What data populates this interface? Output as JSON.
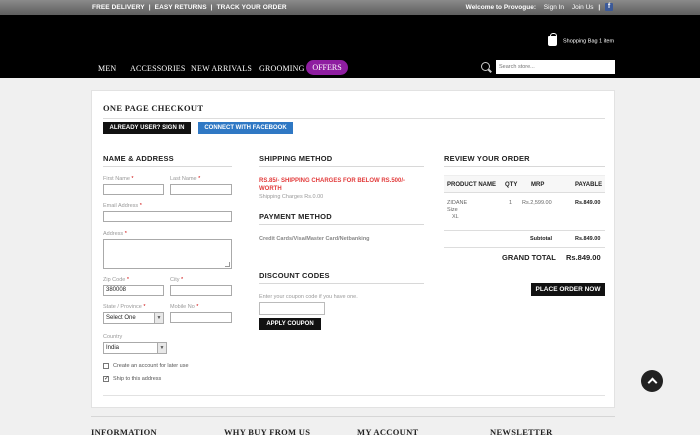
{
  "topbar": {
    "links": [
      "FREE DELIVERY",
      "EASY RETURNS",
      "TRACK YOUR ORDER"
    ],
    "welcome": "Welcome to Provogue:",
    "sign_in": "Sign In",
    "join_us": "Join Us",
    "social_icon": "facebook-icon"
  },
  "header": {
    "bag_label": "Shopping Bag",
    "bag_count": "1 item",
    "nav": [
      "MEN",
      "ACCESSORIES",
      "NEW ARRIVALS",
      "GROOMING",
      "OFFERS"
    ],
    "search_placeholder": "Search store..."
  },
  "checkout": {
    "title": "ONE PAGE CHECKOUT",
    "signin_button": "ALREADY USER? SIGN IN",
    "facebook_button": "CONNECT WITH FACEBOOK"
  },
  "address": {
    "title": "NAME & ADDRESS",
    "first_name_label": "First Name",
    "last_name_label": "Last Name",
    "email_label": "Email Address",
    "address_label": "Address",
    "zip_label": "Zip Code",
    "zip_value": "380008",
    "city_label": "City",
    "state_label": "State / Province",
    "state_value": "Select One",
    "mobile_label": "Mobile No",
    "country_label": "Country",
    "country_value": "India",
    "create_account_label": "Create an account for later use",
    "ship_here_label": "Ship to this address",
    "required_mark": "*"
  },
  "shipping": {
    "title": "SHIPPING METHOD",
    "notice": "RS.85/- SHIPPING CHARGES FOR BELOW RS.500/- WORTH",
    "charges_label": "Shipping Charges",
    "charges_value": "Rs.0.00"
  },
  "payment": {
    "title": "PAYMENT METHOD",
    "methods": "Credit Cards/Visa/Master Card/Netbanking"
  },
  "discount": {
    "title": "DISCOUNT CODES",
    "hint": "Enter your coupon code if you have one.",
    "apply_button": "APPLY COUPON"
  },
  "order": {
    "title": "REVIEW YOUR ORDER",
    "columns": [
      "PRODUCT NAME",
      "QTY",
      "MRP",
      "PAYABLE"
    ],
    "item": {
      "name": "ZIDANE",
      "size_label": "Size",
      "size_value": "XL",
      "qty": "1",
      "mrp": "Rs.2,599.00",
      "payable": "Rs.849.00"
    },
    "subtotal_label": "Subtotal",
    "subtotal_value": "Rs.849.00",
    "grand_total_label": "GRAND TOTAL",
    "grand_total_value": "Rs.849.00",
    "place_order_button": "PLACE ORDER NOW"
  },
  "footer": {
    "headings": [
      "INFORMATION",
      "WHY BUY FROM US",
      "MY ACCOUNT",
      "NEWSLETTER"
    ]
  }
}
